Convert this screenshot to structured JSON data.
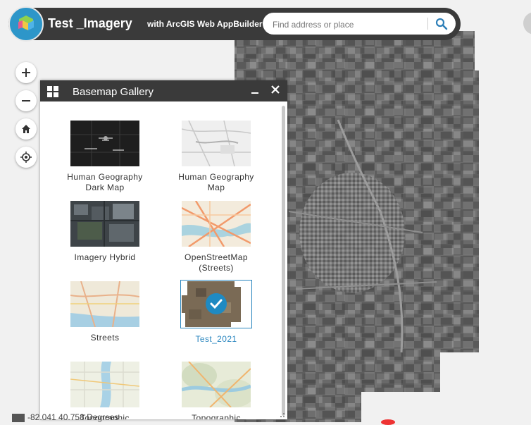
{
  "header": {
    "title": "Test _Imagery",
    "subtitle": "with ArcGIS Web AppBuilder",
    "search_placeholder": "Find address or place",
    "brand_color": "#2d96c9",
    "bar_color": "#3a3a3a"
  },
  "map_controls": [
    {
      "name": "zoom-in-button",
      "icon": "plus-icon"
    },
    {
      "name": "zoom-out-button",
      "icon": "minus-icon"
    },
    {
      "name": "home-button",
      "icon": "home-icon"
    },
    {
      "name": "my-location-button",
      "icon": "locate-icon"
    }
  ],
  "panel": {
    "title": "Basemap Gallery",
    "selected_color": "#2a86bf",
    "items": [
      {
        "label": "Human Geography Dark Map",
        "thumb": "dark",
        "selected": false
      },
      {
        "label": "Human Geography Map",
        "thumb": "light",
        "selected": false
      },
      {
        "label": "Imagery Hybrid",
        "thumb": "imagery",
        "selected": false
      },
      {
        "label": "OpenStreetMap (Streets)",
        "thumb": "osm",
        "selected": false
      },
      {
        "label": "Streets",
        "thumb": "streets",
        "selected": false
      },
      {
        "label": "Test_2021",
        "thumb": "test",
        "selected": true
      },
      {
        "label": "Topographic",
        "thumb": "topo1",
        "selected": false
      },
      {
        "label": "Topographic",
        "thumb": "topo2",
        "selected": false
      }
    ]
  },
  "coordinates": "-82.041 40.758 Degrees"
}
